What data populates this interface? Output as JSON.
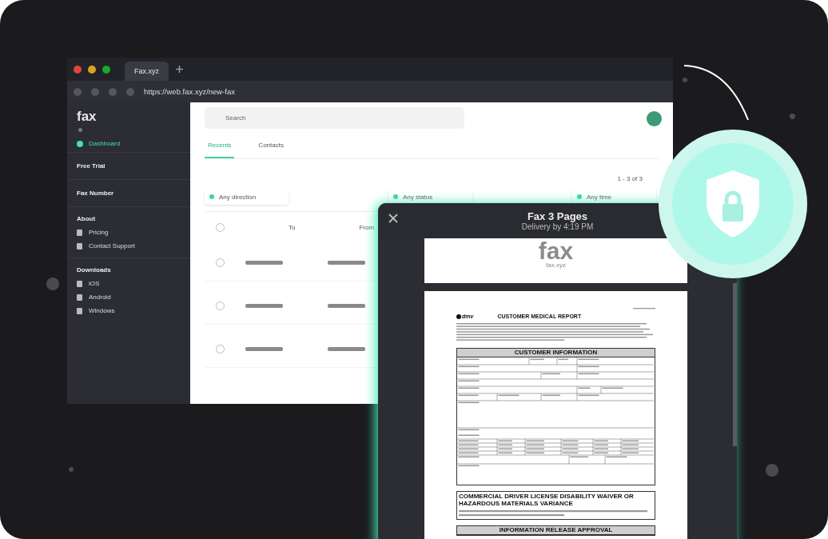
{
  "browser": {
    "tab_title": "Fax.xyz",
    "url": "https://web.fax.xyz/new-fax"
  },
  "sidebar": {
    "logo": "fax",
    "nav": [
      {
        "label": "Dashboard",
        "selected": true
      }
    ],
    "plans": [
      {
        "label": "Free Trial"
      },
      {
        "label": "Fax Number"
      }
    ],
    "groups": [
      {
        "title": "About",
        "items": [
          "Pricing",
          "Contact Support"
        ]
      },
      {
        "title": "Downloads",
        "items": [
          "iOS",
          "Android",
          "Windows"
        ]
      }
    ]
  },
  "main": {
    "search": {
      "placeholder": "Search"
    },
    "tabs": [
      {
        "label": "Recents",
        "selected": true
      },
      {
        "label": "Contacts",
        "selected": false
      }
    ],
    "pagination": "1 - 3 of 3",
    "filters": [
      "Any direction",
      "Any status",
      "Any time"
    ],
    "select_all": {
      "checked": false
    },
    "columns": [
      "To",
      "From"
    ],
    "rows": [
      {
        "checked": false
      },
      {
        "checked": false
      },
      {
        "checked": false
      }
    ]
  },
  "modal": {
    "title": "Fax 3 Pages",
    "subtitle": "Delivery by 4:19 PM",
    "cover": {
      "logo": "fax",
      "site": "fax.xyz"
    },
    "document": {
      "agency": "dmv",
      "title": "CUSTOMER MEDICAL REPORT",
      "sections": [
        {
          "kind": "boxed",
          "heading": "CUSTOMER INFORMATION"
        },
        {
          "kind": "open",
          "heading": "COMMERCIAL DRIVER LICENSE DISABILITY WAIVER OR HAZARDOUS MATERIALS VARIANCE"
        },
        {
          "kind": "boxed",
          "heading": "INFORMATION RELEASE APPROVAL"
        }
      ]
    }
  }
}
